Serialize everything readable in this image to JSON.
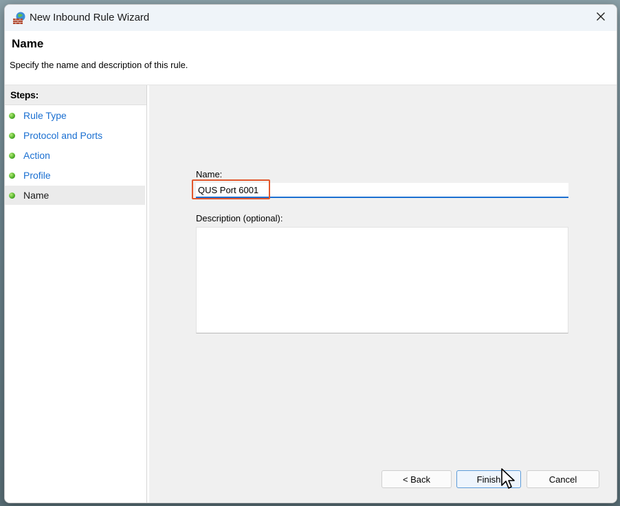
{
  "window": {
    "title": "New Inbound Rule Wizard"
  },
  "header": {
    "title": "Name",
    "subtitle": "Specify the name and description of this rule."
  },
  "steps": {
    "heading": "Steps:",
    "items": [
      {
        "label": "Rule Type",
        "current": false
      },
      {
        "label": "Protocol and Ports",
        "current": false
      },
      {
        "label": "Action",
        "current": false
      },
      {
        "label": "Profile",
        "current": false
      },
      {
        "label": "Name",
        "current": true
      }
    ]
  },
  "form": {
    "name_label": "Name:",
    "name_value": "QUS Port 6001",
    "description_label": "Description (optional):",
    "description_value": ""
  },
  "buttons": {
    "back": "< Back",
    "finish": "Finish",
    "cancel": "Cancel"
  },
  "colors": {
    "link": "#1a6fd1",
    "highlight": "#e2572c",
    "step_dot": "#55b32c"
  },
  "icons": {
    "app": "firewall-icon",
    "close": "close-icon",
    "cursor": "mouse-pointer-icon"
  }
}
